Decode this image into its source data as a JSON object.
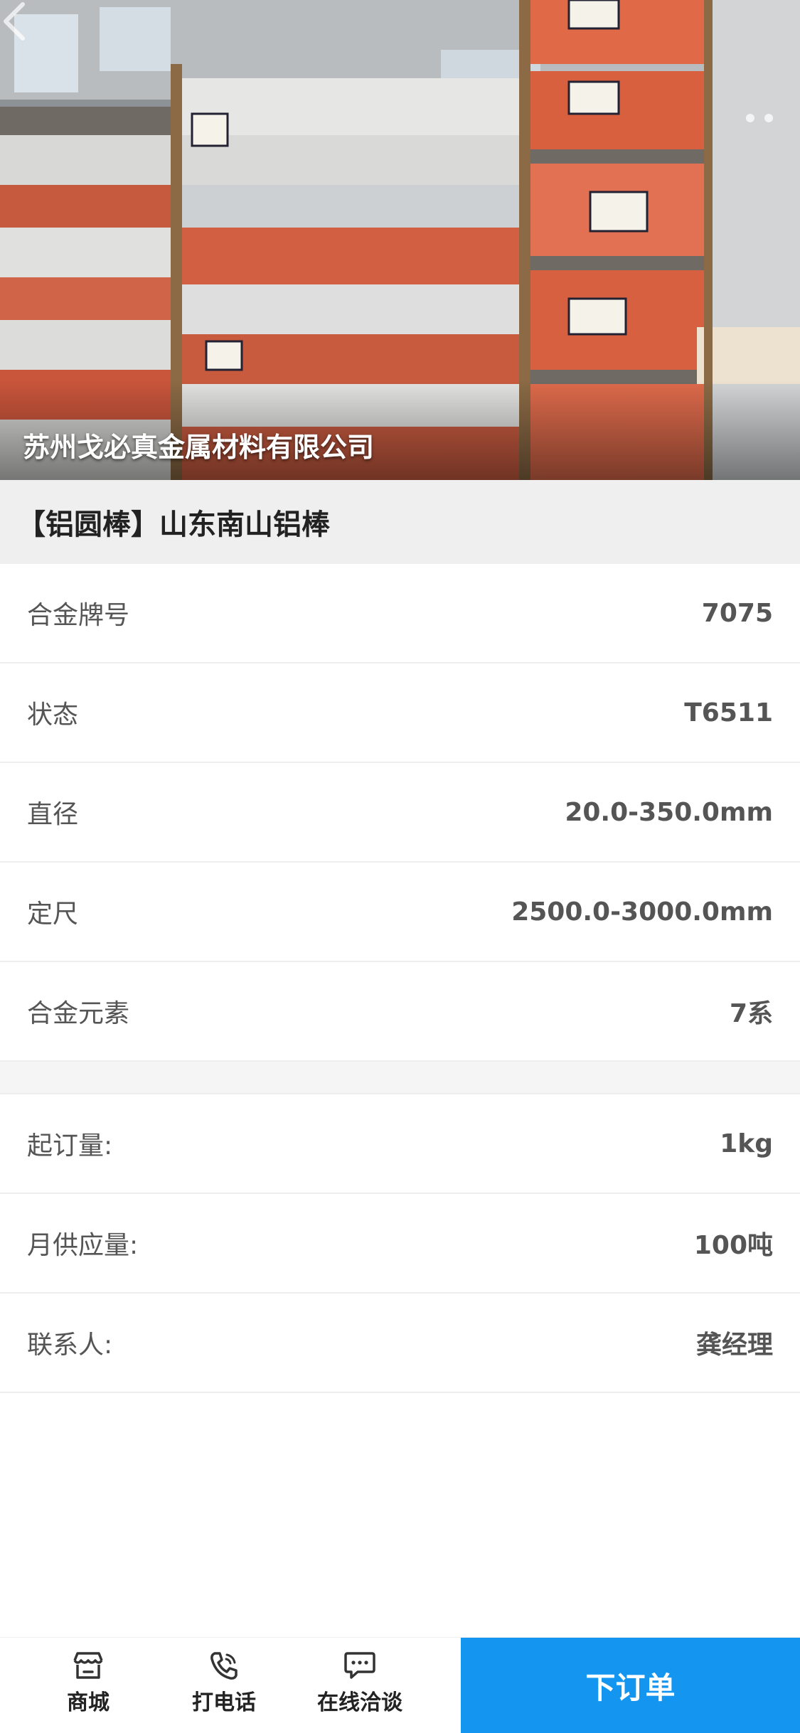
{
  "hero": {
    "company_name": "苏州戈必真金属材料有限公司",
    "image_subject": "warehouse-aluminum-bars-photo"
  },
  "product": {
    "title": "【铝圆棒】山东南山铝棒"
  },
  "specs": [
    {
      "label": "合金牌号",
      "value": "7075"
    },
    {
      "label": "状态",
      "value": "T6511"
    },
    {
      "label": "直径",
      "value": "20.0-350.0mm"
    },
    {
      "label": "定尺",
      "value": "2500.0-3000.0mm"
    },
    {
      "label": "合金元素",
      "value": "7系"
    }
  ],
  "order_info": [
    {
      "label": "起订量:",
      "value": "1kg"
    },
    {
      "label": "月供应量:",
      "value": "100吨"
    },
    {
      "label": "联系人:",
      "value": "龚经理"
    }
  ],
  "bottom_nav": {
    "shop": {
      "label": "商城",
      "icon": "shop-icon"
    },
    "call": {
      "label": "打电话",
      "icon": "phone-icon"
    },
    "chat": {
      "label": "在线洽谈",
      "icon": "chat-icon"
    },
    "order_button": "下订单"
  },
  "colors": {
    "accent": "#1496f0",
    "title_bg": "#efefef"
  }
}
